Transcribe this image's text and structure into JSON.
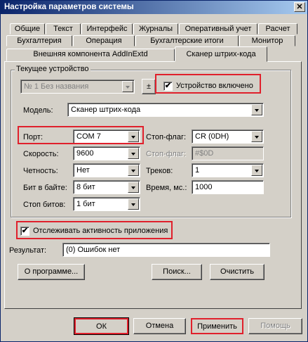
{
  "window": {
    "title": "Настройка параметров системы",
    "close_glyph": "✕"
  },
  "tabs": {
    "row1": [
      "Общие",
      "Текст",
      "Интерфейс",
      "Журналы",
      "Оперативный учет",
      "Расчет"
    ],
    "row2": [
      "Бухгалтерия",
      "Операция",
      "Бухгалтерские итоги",
      "Монитор"
    ],
    "row3": [
      "Внешняя компонента AddInExtd",
      "Сканер штрих-кода"
    ]
  },
  "group": {
    "label": "Текущее устройство"
  },
  "device": {
    "value": "№ 1 Без названия",
    "plusminus": "±",
    "enabled_label": "Устройство включено",
    "enabled_check": "✔"
  },
  "model": {
    "label": "Модель:",
    "value": "Сканер штрих-кода"
  },
  "port": {
    "label": "Порт:",
    "value": "COM 7"
  },
  "stop_flag": {
    "label": "Стоп-флаг:",
    "value": "CR (0DH)"
  },
  "speed": {
    "label": "Скорость:",
    "value": "9600"
  },
  "stop_flag2": {
    "label": "Стоп-флаг:",
    "value": "#$0D"
  },
  "parity": {
    "label": "Четность:",
    "value": "Нет"
  },
  "tracks": {
    "label": "Треков:",
    "value": "1"
  },
  "bits": {
    "label": "Бит в байте:",
    "value": "8 бит"
  },
  "time": {
    "label": "Время, мс.:",
    "value": "1000"
  },
  "stopbits": {
    "label": "Стоп битов:",
    "value": "1 бит"
  },
  "track_activity": {
    "label": "Отслеживать активность приложения",
    "check": "✔"
  },
  "result": {
    "label": "Результат:",
    "value": "(0) Ошибок нет"
  },
  "buttons": {
    "about": "О программе...",
    "search": "Поиск...",
    "clear": "Очистить",
    "ok": "ОК",
    "cancel": "Отмена",
    "apply": "Применить",
    "help": "Помощь"
  },
  "colors": {
    "titlebar_start": "#0a246a",
    "titlebar_end": "#a6caf0",
    "highlight": "#e0202c",
    "face": "#d4d0c8"
  }
}
